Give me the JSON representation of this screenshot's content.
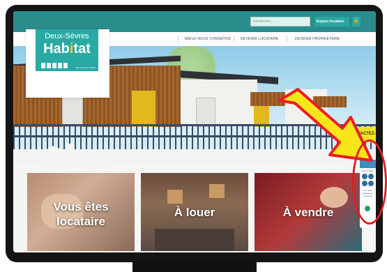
{
  "header": {
    "search_placeholder": "Rechercher...",
    "espace_label": "Espace locataire"
  },
  "nav": {
    "items": [
      "MIEUX NOUS CONNAÎTRE",
      "DEVENIR LOCATAIRE",
      "DEVENIR PROPRIÉTAIRE"
    ]
  },
  "logo": {
    "top": "Deux-Sèvres",
    "main_a": "Hab",
    "main_b": "i",
    "main_c": "tat",
    "tagline": "Bien vivre son habitat"
  },
  "hero": {
    "contact_label": "CONTACTEZ-NOUS"
  },
  "tiles": [
    {
      "label": "Vous êtes locataire"
    },
    {
      "label": "À louer"
    },
    {
      "label": "À vendre"
    }
  ],
  "accessibility": {
    "title": "Accessibilité",
    "text": "Une visite adaptée au handicap"
  },
  "colors": {
    "teal": "#29a9a4",
    "yellow": "#f3e11f",
    "annotation_red": "#e21d1d",
    "arrow_yellow": "#f7e61a",
    "arrow_red": "#ee1c24"
  },
  "icons": [
    "lock-icon",
    "search-icon",
    "accessibility-icon",
    "arrow-annotation-icon"
  ]
}
